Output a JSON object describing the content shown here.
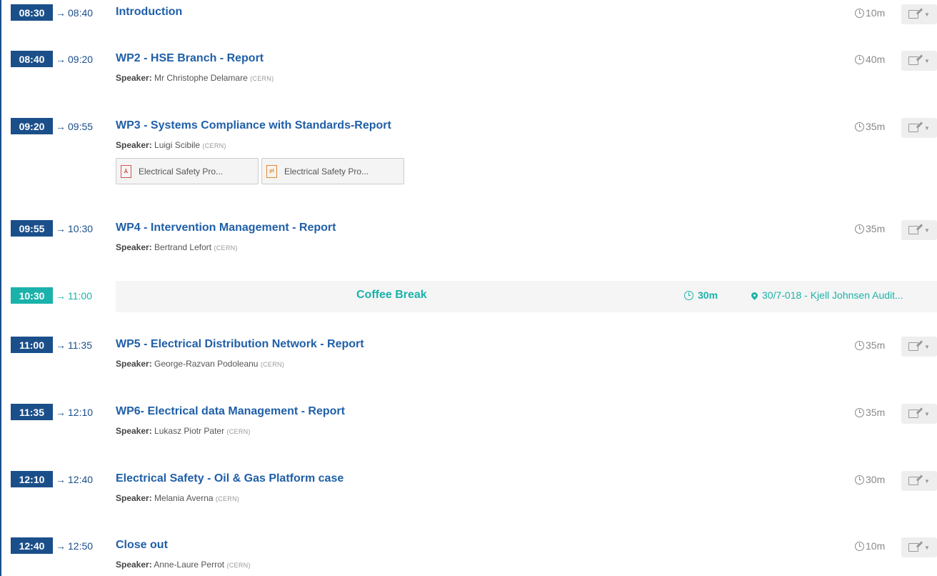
{
  "speaker_label": "Speaker:",
  "entries": [
    {
      "start": "08:30",
      "end": "08:40",
      "title": "Introduction",
      "duration": "10m"
    },
    {
      "start": "08:40",
      "end": "09:20",
      "title": "WP2 - HSE Branch - Report",
      "speaker": "Mr Christophe Delamare",
      "affiliation": "(CERN)",
      "duration": "40m"
    },
    {
      "start": "09:20",
      "end": "09:55",
      "title": "WP3 - Systems Compliance with Standards-Report",
      "speaker": "Luigi Scibile",
      "affiliation": "(CERN)",
      "duration": "35m",
      "attachments": [
        {
          "label": "Electrical Safety Pro...",
          "icon": "pdf-file-icon"
        },
        {
          "label": "Electrical Safety Pro...",
          "icon": "presentation-file-icon"
        }
      ]
    },
    {
      "start": "09:55",
      "end": "10:30",
      "title": "WP4 - Intervention Management - Report",
      "speaker": "Bertrand Lefort",
      "affiliation": "(CERN)",
      "duration": "35m"
    },
    {
      "start": "10:30",
      "end": "11:00",
      "title": "Coffee Break",
      "duration": "30m",
      "location": "30/7-018 - Kjell Johnsen Audit...",
      "is_break": true
    },
    {
      "start": "11:00",
      "end": "11:35",
      "title": "WP5 - Electrical Distribution Network - Report",
      "speaker": "George-Razvan Podoleanu",
      "affiliation": "(CERN)",
      "duration": "35m"
    },
    {
      "start": "11:35",
      "end": "12:10",
      "title": "WP6- Electrical data Management - Report",
      "speaker": "Lukasz Piotr Pater",
      "affiliation": "(CERN)",
      "duration": "35m"
    },
    {
      "start": "12:10",
      "end": "12:40",
      "title": "Electrical Safety - Oil & Gas Platform case",
      "speaker": "Melania Averna",
      "affiliation": "(CERN)",
      "duration": "30m"
    },
    {
      "start": "12:40",
      "end": "12:50",
      "title": "Close out",
      "speaker": "Anne-Laure Perrot",
      "affiliation": "(CERN)",
      "duration": "10m"
    }
  ],
  "colors": {
    "primary": "#1b4f8a",
    "link": "#1f5fa8",
    "break": "#1ab2aa"
  }
}
